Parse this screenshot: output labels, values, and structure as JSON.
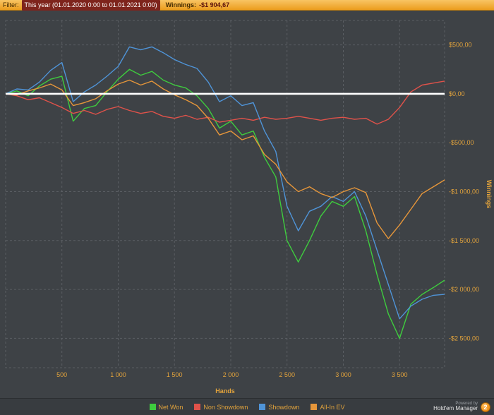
{
  "filter_bar": {
    "filter_label": "Filter:",
    "filter_value": "This year (01.01.2020 0:00 to 01.01.2021 0:00)",
    "winnings_label": "Winnings:",
    "winnings_value": "-$1 904,67"
  },
  "chart_data": {
    "type": "line",
    "title": "",
    "xlabel": "Hands",
    "ylabel": "Winnings",
    "xlim": [
      0,
      3900
    ],
    "ylim": [
      -2800,
      750
    ],
    "grid": true,
    "legend_position": "bottom",
    "zero_line_color": "#ffffff",
    "x_ticks": [
      500,
      1000,
      1500,
      2000,
      2500,
      3000,
      3500
    ],
    "x_tick_labels": [
      "500",
      "1 000",
      "1 500",
      "2 000",
      "2 500",
      "3 000",
      "3 500"
    ],
    "y_ticks": [
      500,
      0,
      -500,
      -1000,
      -1500,
      -2000,
      -2500
    ],
    "y_tick_labels": [
      "$500,00",
      "$0,00",
      "-$500,00",
      "-$1 000,00",
      "-$1 500,00",
      "-$2 000,00",
      "-$2 500,00"
    ],
    "x": [
      0,
      100,
      200,
      300,
      400,
      500,
      600,
      700,
      800,
      900,
      1000,
      1100,
      1200,
      1300,
      1400,
      1500,
      1600,
      1700,
      1800,
      1900,
      2000,
      2100,
      2200,
      2300,
      2400,
      2500,
      2600,
      2700,
      2800,
      2900,
      3000,
      3100,
      3200,
      3300,
      3400,
      3500,
      3600,
      3700,
      3800,
      3900
    ],
    "series": [
      {
        "name": "Net Won",
        "color": "#3ecc3e",
        "values": [
          0,
          30,
          -20,
          80,
          150,
          180,
          -280,
          -150,
          -120,
          20,
          150,
          250,
          190,
          230,
          140,
          90,
          60,
          -20,
          -150,
          -350,
          -280,
          -420,
          -380,
          -650,
          -850,
          -1500,
          -1720,
          -1500,
          -1250,
          -1100,
          -1150,
          -1050,
          -1400,
          -1850,
          -2250,
          -2500,
          -2150,
          -2050,
          -1980,
          -1905
        ]
      },
      {
        "name": "Non Showdown",
        "color": "#e0524a",
        "values": [
          0,
          -20,
          -60,
          -40,
          -90,
          -140,
          -200,
          -170,
          -210,
          -160,
          -130,
          -170,
          -200,
          -180,
          -230,
          -250,
          -220,
          -260,
          -240,
          -290,
          -270,
          -250,
          -270,
          -240,
          -260,
          -250,
          -230,
          -250,
          -270,
          -250,
          -240,
          -260,
          -250,
          -310,
          -260,
          -140,
          20,
          90,
          110,
          130
        ]
      },
      {
        "name": "Showdown",
        "color": "#4f94d8",
        "values": [
          0,
          50,
          40,
          120,
          240,
          320,
          -80,
          20,
          90,
          180,
          280,
          480,
          450,
          480,
          420,
          350,
          300,
          260,
          120,
          -80,
          -20,
          -120,
          -90,
          -380,
          -590,
          -1150,
          -1400,
          -1200,
          -1150,
          -1050,
          -1100,
          -1000,
          -1250,
          -1600,
          -1950,
          -2300,
          -2170,
          -2100,
          -2060,
          -2050
        ]
      },
      {
        "name": "All-In EV",
        "color": "#e6963a",
        "values": [
          0,
          -10,
          30,
          60,
          100,
          40,
          -120,
          -90,
          -50,
          30,
          100,
          140,
          90,
          130,
          50,
          -10,
          -60,
          -120,
          -250,
          -420,
          -380,
          -470,
          -430,
          -620,
          -720,
          -900,
          -1000,
          -950,
          -1020,
          -1060,
          -1000,
          -960,
          -1010,
          -1320,
          -1480,
          -1340,
          -1180,
          -1020,
          -950,
          -880
        ]
      }
    ]
  },
  "footer": {
    "powered_by": "Powered by",
    "brand": "Hold'em Manager",
    "brand_badge": "2"
  },
  "colors": {
    "background": "#3e4246",
    "grid": "#5a5e63",
    "axis_text": "#e2a33c",
    "topbar_from": "#f8c464",
    "topbar_to": "#ec9d1e",
    "filter_highlight": "#7e241c",
    "legend_bar": "#383c40"
  }
}
